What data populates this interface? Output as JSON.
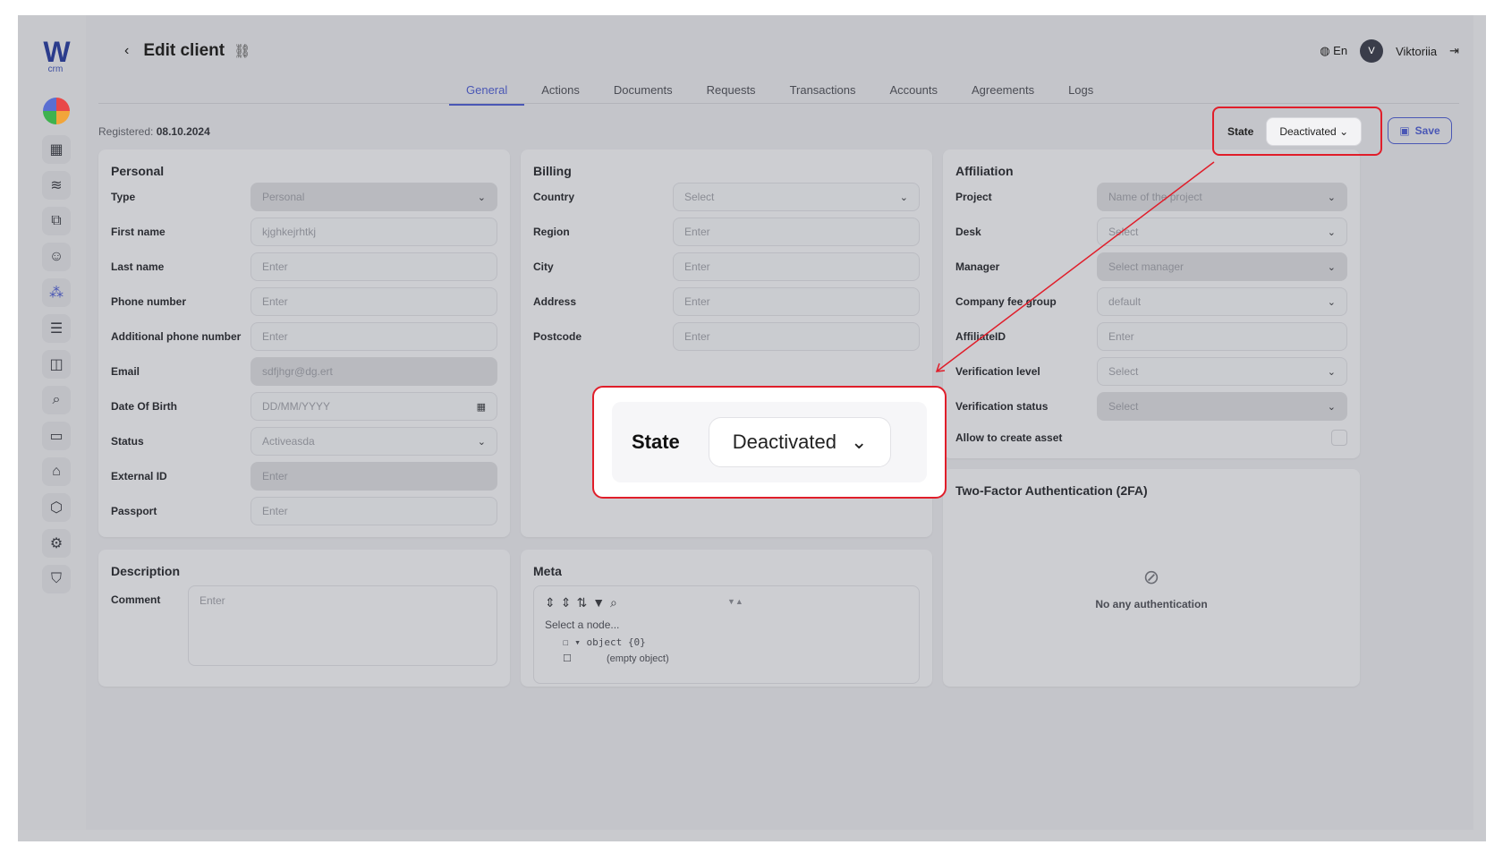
{
  "app": {
    "logo": "W",
    "logo_sub": "crm"
  },
  "header": {
    "back": "‹",
    "title": "Edit client",
    "language": "En",
    "user_initial": "V",
    "user_name": "Viktoriia"
  },
  "tabs": [
    "General",
    "Actions",
    "Documents",
    "Requests",
    "Transactions",
    "Accounts",
    "Agreements",
    "Logs"
  ],
  "registered": {
    "label": "Registered:",
    "value": "08.10.2024"
  },
  "state": {
    "label": "State",
    "value": "Deactivated"
  },
  "save_label": "Save",
  "personal": {
    "title": "Personal",
    "rows": [
      {
        "label": "Type",
        "value": "Personal"
      },
      {
        "label": "First name",
        "value": "kjghkejrhtkj"
      },
      {
        "label": "Last name",
        "value": "Enter"
      },
      {
        "label": "Phone number",
        "value": "Enter"
      },
      {
        "label": "Additional phone number",
        "value": "Enter"
      },
      {
        "label": "Email",
        "value": "sdfjhgr@dg.ert"
      },
      {
        "label": "Date Of Birth",
        "value": "DD/MM/YYYY"
      },
      {
        "label": "Status",
        "value": "Activeasda"
      },
      {
        "label": "External ID",
        "value": "Enter"
      },
      {
        "label": "Passport",
        "value": "Enter"
      }
    ]
  },
  "billing": {
    "title": "Billing",
    "rows": [
      {
        "label": "Country",
        "value": "Select"
      },
      {
        "label": "Region",
        "value": "Enter"
      },
      {
        "label": "City",
        "value": "Enter"
      },
      {
        "label": "Address",
        "value": "Enter"
      },
      {
        "label": "Postcode",
        "value": "Enter"
      }
    ]
  },
  "affiliation": {
    "title": "Affiliation",
    "rows": [
      {
        "label": "Project",
        "value": "Name of the project"
      },
      {
        "label": "Desk",
        "value": "Select"
      },
      {
        "label": "Manager",
        "value": "Select manager"
      },
      {
        "label": "Company fee group",
        "value": "default"
      },
      {
        "label": "AffiliateID",
        "value": "Enter"
      },
      {
        "label": "Verification level",
        "value": "Select"
      },
      {
        "label": "Verification status",
        "value": "Select"
      }
    ],
    "allow_asset": "Allow to create asset"
  },
  "twofa": {
    "title": "Two-Factor Authentication (2FA)",
    "empty": "No any authentication"
  },
  "description": {
    "title": "Description",
    "comment_label": "Comment",
    "comment_placeholder": "Enter"
  },
  "meta": {
    "title": "Meta",
    "select_node": "Select a node...",
    "object_label": "object {0}",
    "empty_object": "(empty object)"
  },
  "colors": {
    "accent": "#4a57b5",
    "highlight": "#e01e2a"
  }
}
